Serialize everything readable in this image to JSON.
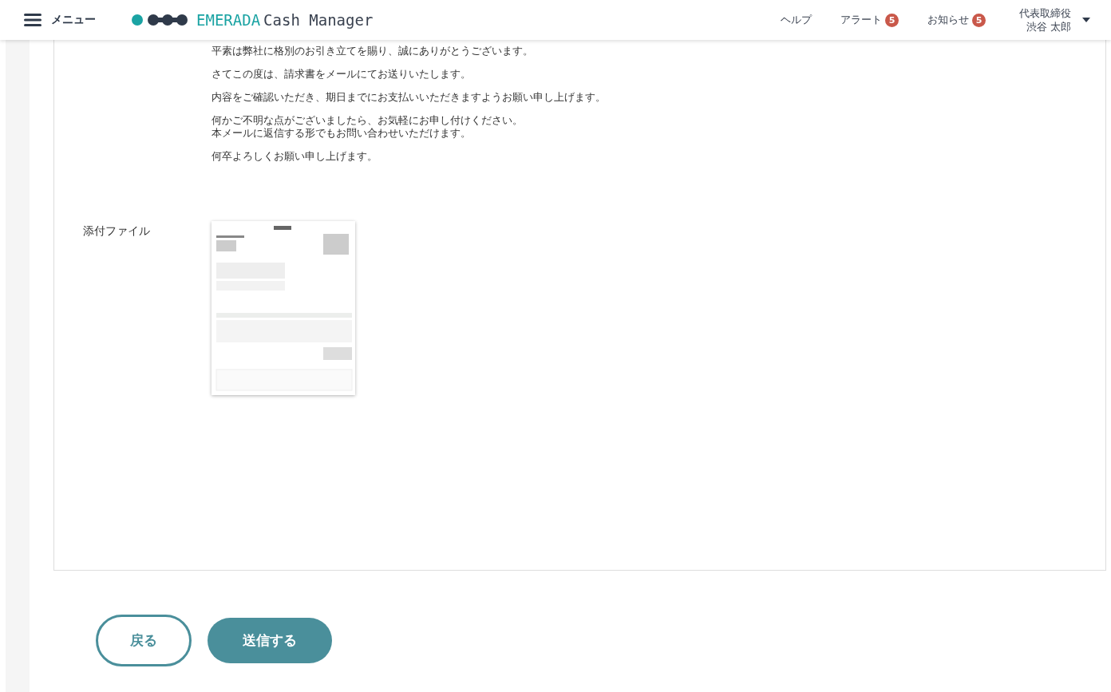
{
  "header": {
    "menu_label": "メニュー",
    "logo": {
      "brand": "EMERADA",
      "product": "Cash Manager"
    },
    "nav": [
      {
        "label": "ヘルプ"
      },
      {
        "label": "アラート",
        "badge": "5"
      },
      {
        "label": "お知らせ",
        "badge": "5"
      }
    ],
    "user": {
      "title": "代表取締役",
      "name": "渋谷 太郎"
    }
  },
  "message": {
    "paragraphs": [
      [
        "平素は弊社に格別のお引き立てを賜り、誠にありがとうございます。"
      ],
      [
        "さてこの度は、請求書をメールにてお送りいたします。"
      ],
      [
        "内容をご確認いただき、期日までにお支払いいただきますようお願い申し上げます。"
      ],
      [
        "何かご不明な点がございましたら、お気軽にお申し付けください。",
        "本メールに返信する形でもお問い合わせいただけます。"
      ],
      [
        "何卒よろしくお願い申し上げます。"
      ]
    ]
  },
  "attachment": {
    "label": "添付ファイル",
    "kind": "picture"
  },
  "buttons": [
    {
      "label": "戻る",
      "kind": "outline"
    },
    {
      "label": "送信する",
      "kind": "primary"
    }
  ]
}
